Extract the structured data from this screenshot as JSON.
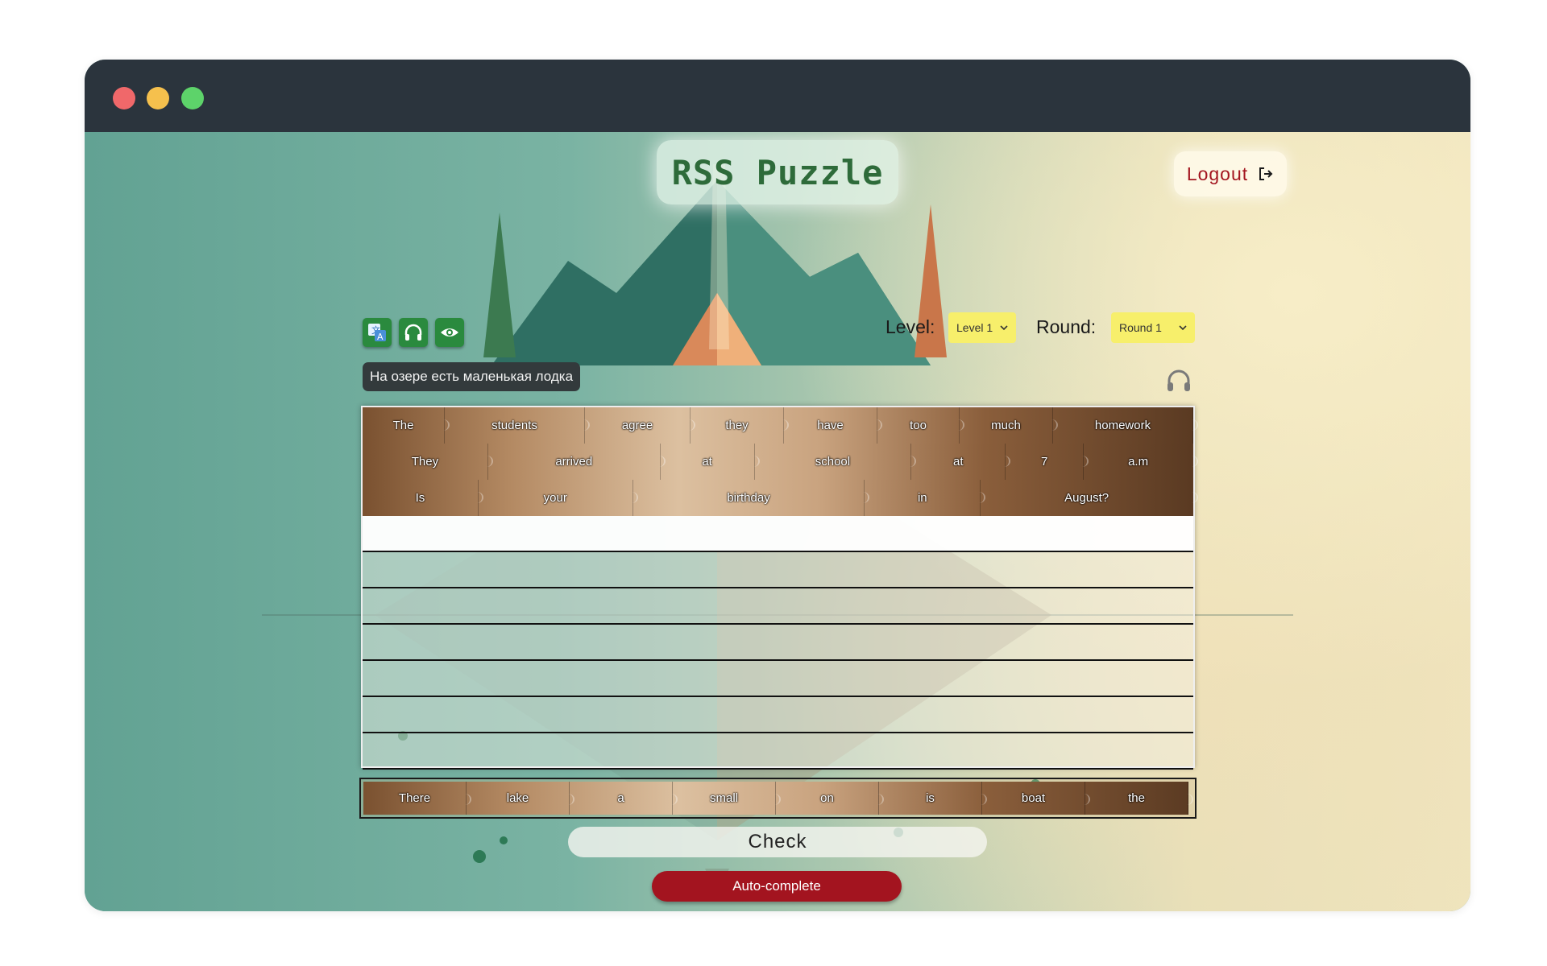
{
  "app": {
    "title": "RSS Puzzle",
    "logout_label": "Logout"
  },
  "colors": {
    "titlebar": "#2b343d",
    "logo_text": "#2e6b3a",
    "logout_text": "#a3151f",
    "hint_button": "#2a8a3e",
    "select_bg": "#f7ef6b",
    "autocomplete_bg": "#a3141f"
  },
  "hints": [
    {
      "name": "translation-hint-button",
      "icon": "translate-icon"
    },
    {
      "name": "audio-hint-button",
      "icon": "headphones-icon"
    },
    {
      "name": "background-hint-button",
      "icon": "eye-icon"
    }
  ],
  "controls": {
    "level_label": "Level:",
    "level_value": "Level 1",
    "round_label": "Round:",
    "round_value": "Round 1"
  },
  "translation": "На озере есть маленькая лодка",
  "completed_rows": [
    [
      "The",
      "students",
      "agree",
      "they",
      "have",
      "too",
      "much",
      "homework"
    ],
    [
      "They",
      "arrived",
      "at",
      "school",
      "at",
      "7",
      "a.m"
    ],
    [
      "Is",
      "your",
      "birthday",
      "in",
      "August?"
    ]
  ],
  "empty_rows": 7,
  "source_words": [
    "There",
    "lake",
    "a",
    "small",
    "on",
    "is",
    "boat",
    "the"
  ],
  "buttons": {
    "check": "Check",
    "autocomplete": "Auto-complete"
  }
}
